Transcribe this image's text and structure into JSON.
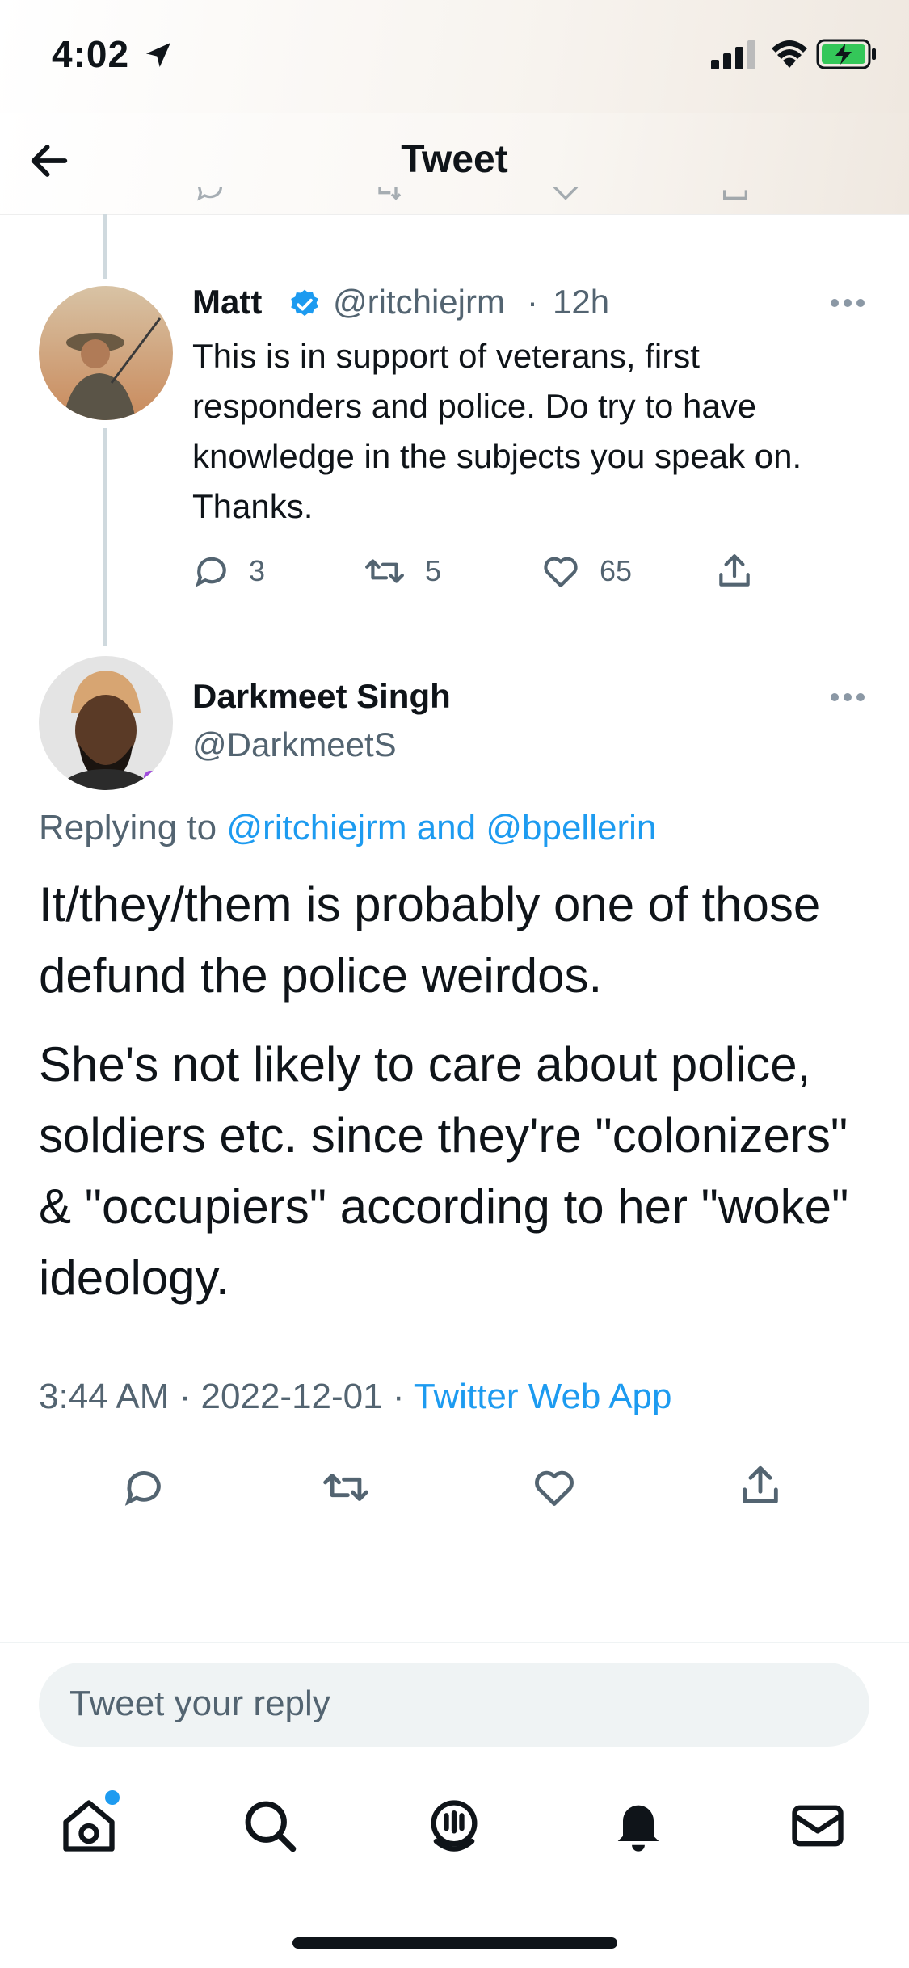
{
  "status_bar": {
    "time": "4:02"
  },
  "header": {
    "title": "Tweet"
  },
  "parent_tweet": {
    "name": "Matt",
    "handle": "@ritchiejrm",
    "separator": "·",
    "time_ago": "12h",
    "text": "This is in support of veterans, first responders and police. Do try to have knowledge in the subjects you speak on. Thanks.",
    "replies": "3",
    "retweets": "5",
    "likes": "65"
  },
  "main_tweet": {
    "name": "Darkmeet Singh",
    "handle": "@DarkmeetS",
    "replying_prefix": "Replying to",
    "replying_to": "@ritchiejrm and @bpellerin",
    "paragraph_1": "It/they/them is probably one of those defund the police weirdos.",
    "paragraph_2": "She's not likely to care about police, soldiers etc. since they're \"colonizers\" & \"occupiers\" according to her \"woke\" ideology.",
    "timestamp": "3:44 AM · 2022-12-01 · ",
    "source": "Twitter Web App"
  },
  "reply_bar": {
    "placeholder": "Tweet your reply"
  },
  "colors": {
    "accent": "#1d9bf0",
    "text": "#0f1419",
    "secondary": "#536471",
    "verified": "#1d9bf0"
  },
  "icons": {
    "nav": [
      "home-icon",
      "search-icon",
      "spaces-icon",
      "notifications-icon",
      "messages-icon"
    ]
  }
}
